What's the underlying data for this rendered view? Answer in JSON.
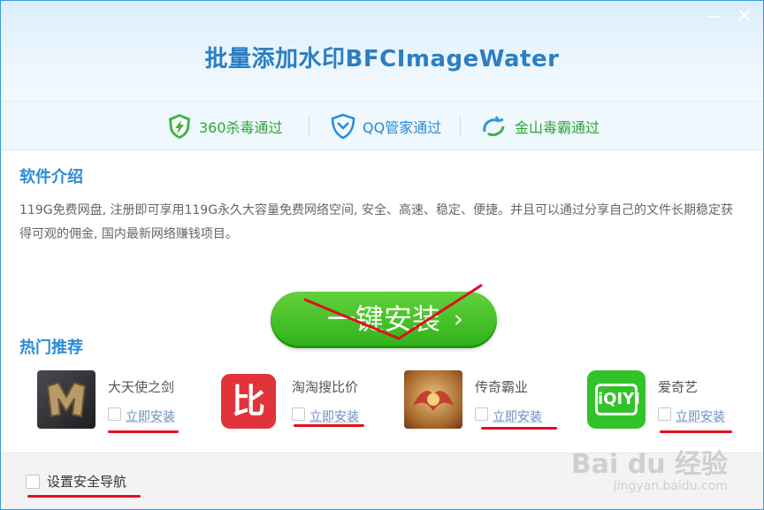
{
  "window": {
    "title": "批量添加水印BFCImageWater",
    "minimize_label": "",
    "close_label": "×"
  },
  "certifications": [
    {
      "label": "360杀毒通过",
      "icon": "shield-bolt-icon"
    },
    {
      "label": "QQ管家通过",
      "icon": "qq-shield-icon"
    },
    {
      "label": "金山毒霸通过",
      "icon": "kingsoft-swirl-icon"
    }
  ],
  "intro": {
    "heading": "软件介绍",
    "text": "119G免费网盘, 注册即可享用119G永久大容量免费网络空间, 安全、高速、稳定、便捷。并且可以通过分享自己的文件长期稳定获得可观的佣金, 国内最新网络赚钱项目。"
  },
  "install_button": {
    "label": "一键安装",
    "arrow": "›"
  },
  "recommend": {
    "heading": "热门推荐",
    "apps": [
      {
        "name": "大天使之剑",
        "install_label": "立即安装",
        "icon": "game-logo-icon"
      },
      {
        "name": "淘淘搜比价",
        "install_label": "立即安装",
        "icon": "bi-logo-icon",
        "icon_text": "比"
      },
      {
        "name": "传奇霸业",
        "install_label": "立即安装",
        "icon": "legend-logo-icon"
      },
      {
        "name": "爱奇艺",
        "install_label": "立即安装",
        "icon": "iqiyi-logo-icon",
        "icon_text": "iQIYI"
      }
    ]
  },
  "footer": {
    "checkbox_label": "设置安全导航"
  },
  "watermark": {
    "brand": "Bai du 经验",
    "url": "jingyan.baidu.com"
  },
  "colors": {
    "accent_blue": "#2b7fc2",
    "install_green": "#3cb824",
    "annotation_red": "#e0101a"
  }
}
